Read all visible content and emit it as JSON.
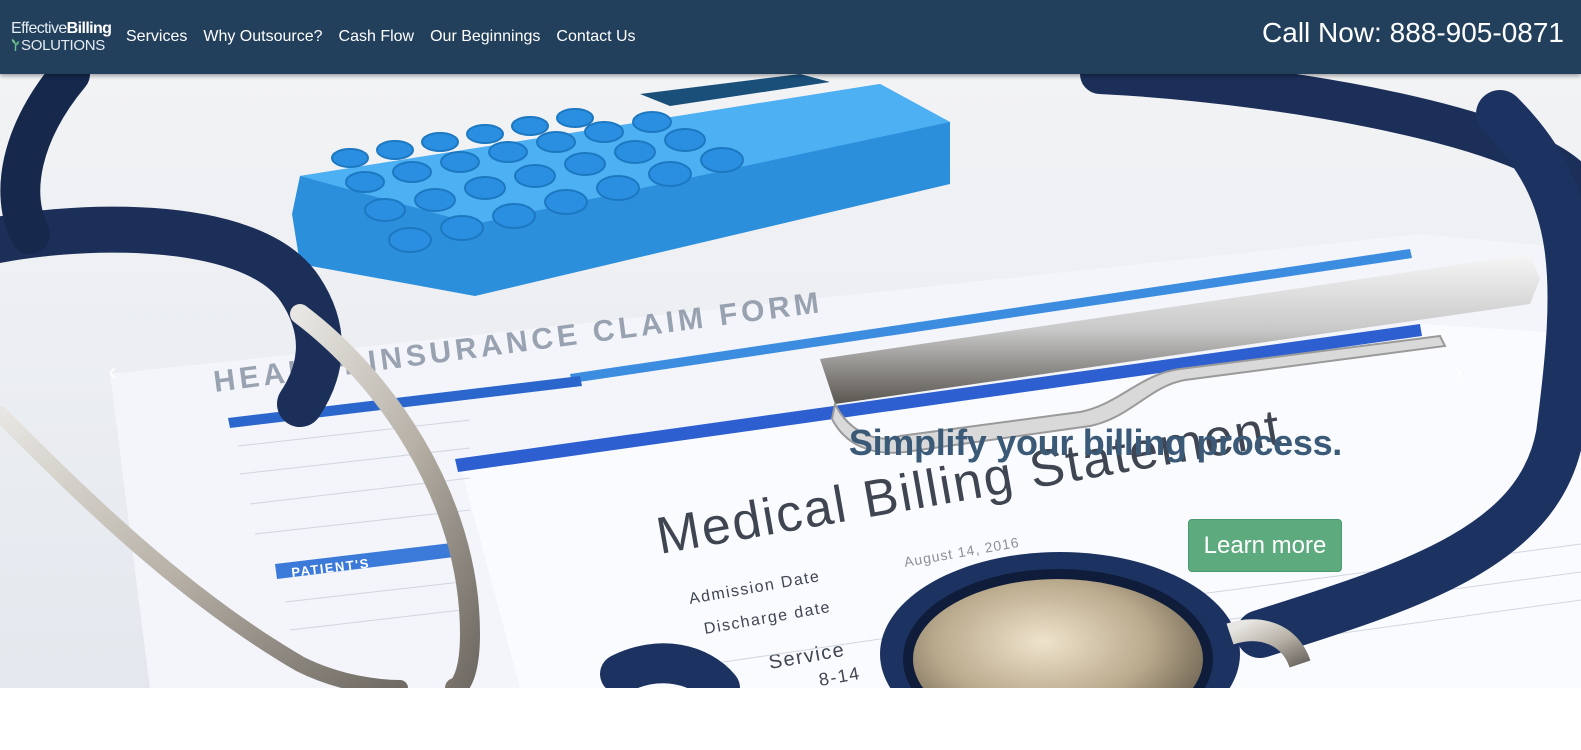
{
  "brand": {
    "logo_effective": "Effective",
    "logo_billing": "Billing",
    "logo_solutions": "SOLUTIONS"
  },
  "nav": {
    "items": [
      {
        "label": "Services"
      },
      {
        "label": "Why Outsource?"
      },
      {
        "label": "Cash Flow"
      },
      {
        "label": "Our Beginnings"
      },
      {
        "label": "Contact Us"
      }
    ],
    "call_now": "Call Now: 888-905-0871"
  },
  "hero": {
    "title": "Simplify your billing process.",
    "cta_label": "Learn more",
    "prev_glyph": "‹",
    "next_glyph": "›",
    "image_text": {
      "form_title": "HEALTH INSURANCE CLAIM FORM",
      "statement": "Medical Billing Statement",
      "admission": "Admission Date",
      "admission_value": "August 14, 2016",
      "discharge": "Discharge date",
      "service": "Service",
      "service_value": "8-14",
      "patient": "PATIENT'S"
    }
  },
  "colors": {
    "navbar": "#223f5c",
    "title": "#3a5a78",
    "cta": "#5daa7f"
  }
}
